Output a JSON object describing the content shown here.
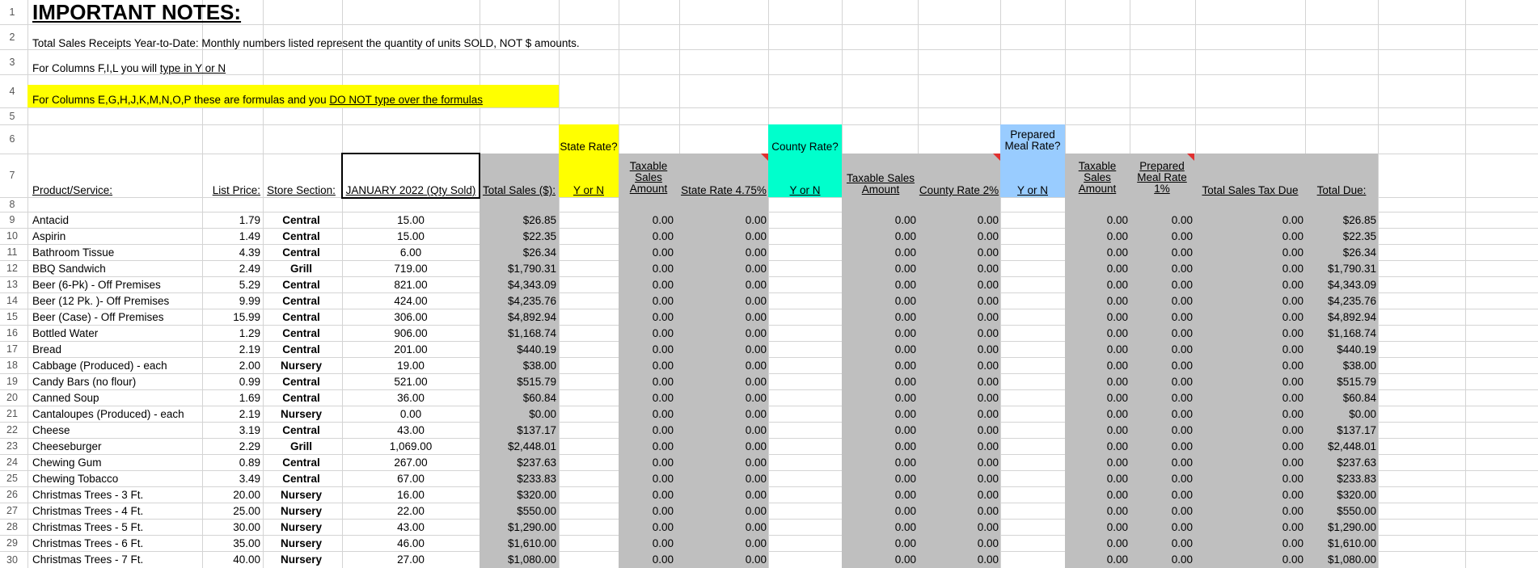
{
  "notes": {
    "title": "IMPORTANT NOTES:",
    "line2": "Total Sales Receipts Year-to-Date:  Monthly numbers listed represent the quantity of units SOLD, NOT $ amounts.",
    "line3_prefix": "For Columns F,I,L you will ",
    "line3_link": "type in Y or N",
    "line4_prefix": "For Columns E,G,H,J,K,M,N,O,P these are formulas and you ",
    "line4_link": "DO NOT type over the formulas"
  },
  "headers": {
    "product": "Product/Service:",
    "list_price": "List Price:",
    "store_section": "Store Section:",
    "qty": "JANUARY 2022  (Qty Sold)",
    "total_sales": "Total Sales ($):",
    "state_rate_q": "State Rate?",
    "state_yn": "Y or N",
    "taxable_state": "Taxable Sales Amount",
    "state_rate": "State Rate 4.75%",
    "county_rate_q": "County Rate?",
    "county_yn": "Y or N",
    "taxable_county": "Taxable Sales Amount",
    "county_rate": "County Rate 2%",
    "meal_rate_q": "Prepared Meal Rate?",
    "meal_yn": "Y or N",
    "taxable_meal": "Taxable Sales Amount",
    "meal_rate": "Prepared Meal Rate 1%",
    "tax_due": "Total Sales Tax Due",
    "total_due": "Total Due:"
  },
  "row_numbers": [
    "1",
    "2",
    "3",
    "4",
    "5",
    "6",
    "7",
    "8",
    "9",
    "10",
    "11",
    "12",
    "13",
    "14",
    "15",
    "16",
    "17",
    "18",
    "19",
    "20",
    "21",
    "22",
    "23",
    "24",
    "25",
    "26",
    "27",
    "28",
    "29",
    "30"
  ],
  "zero": "0.00",
  "colors": {
    "yellow": "#ffff00",
    "aqua": "#00ffcc",
    "light_blue": "#99ccff",
    "gray": "#bfbfbf",
    "grid": "#d4d4d4",
    "marker": "#e03030"
  },
  "rows": [
    {
      "product": "Antacid",
      "price": "1.79",
      "section": "Central",
      "qty": "15.00",
      "sales": "$26.85",
      "total": "$26.85"
    },
    {
      "product": "Aspirin",
      "price": "1.49",
      "section": "Central",
      "qty": "15.00",
      "sales": "$22.35",
      "total": "$22.35"
    },
    {
      "product": "Bathroom Tissue",
      "price": "4.39",
      "section": "Central",
      "qty": "6.00",
      "sales": "$26.34",
      "total": "$26.34"
    },
    {
      "product": "BBQ Sandwich",
      "price": "2.49",
      "section": "Grill",
      "qty": "719.00",
      "sales": "$1,790.31",
      "total": "$1,790.31"
    },
    {
      "product": "Beer (6-Pk) - Off Premises",
      "price": "5.29",
      "section": "Central",
      "qty": "821.00",
      "sales": "$4,343.09",
      "total": "$4,343.09"
    },
    {
      "product": "Beer (12 Pk. )- Off Premises",
      "price": "9.99",
      "section": "Central",
      "qty": "424.00",
      "sales": "$4,235.76",
      "total": "$4,235.76"
    },
    {
      "product": "Beer (Case) - Off Premises",
      "price": "15.99",
      "section": "Central",
      "qty": "306.00",
      "sales": "$4,892.94",
      "total": "$4,892.94"
    },
    {
      "product": "Bottled Water",
      "price": "1.29",
      "section": "Central",
      "qty": "906.00",
      "sales": "$1,168.74",
      "total": "$1,168.74"
    },
    {
      "product": "Bread",
      "price": "2.19",
      "section": "Central",
      "qty": "201.00",
      "sales": "$440.19",
      "total": "$440.19"
    },
    {
      "product": "Cabbage (Produced) - each",
      "price": "2.00",
      "section": "Nursery",
      "qty": "19.00",
      "sales": "$38.00",
      "total": "$38.00"
    },
    {
      "product": "Candy Bars (no flour)",
      "price": "0.99",
      "section": "Central",
      "qty": "521.00",
      "sales": "$515.79",
      "total": "$515.79"
    },
    {
      "product": "Canned Soup",
      "price": "1.69",
      "section": "Central",
      "qty": "36.00",
      "sales": "$60.84",
      "total": "$60.84"
    },
    {
      "product": "Cantaloupes (Produced) - each",
      "price": "2.19",
      "section": "Nursery",
      "qty": "0.00",
      "sales": "$0.00",
      "total": "$0.00"
    },
    {
      "product": "Cheese",
      "price": "3.19",
      "section": "Central",
      "qty": "43.00",
      "sales": "$137.17",
      "total": "$137.17"
    },
    {
      "product": "Cheeseburger",
      "price": "2.29",
      "section": "Grill",
      "qty": "1,069.00",
      "sales": "$2,448.01",
      "total": "$2,448.01"
    },
    {
      "product": "Chewing Gum",
      "price": "0.89",
      "section": "Central",
      "qty": "267.00",
      "sales": "$237.63",
      "total": "$237.63"
    },
    {
      "product": "Chewing Tobacco",
      "price": "3.49",
      "section": "Central",
      "qty": "67.00",
      "sales": "$233.83",
      "total": "$233.83"
    },
    {
      "product": "Christmas Trees - 3 Ft.",
      "price": "20.00",
      "section": "Nursery",
      "qty": "16.00",
      "sales": "$320.00",
      "total": "$320.00"
    },
    {
      "product": "Christmas Trees - 4 Ft.",
      "price": "25.00",
      "section": "Nursery",
      "qty": "22.00",
      "sales": "$550.00",
      "total": "$550.00"
    },
    {
      "product": "Christmas Trees - 5 Ft.",
      "price": "30.00",
      "section": "Nursery",
      "qty": "43.00",
      "sales": "$1,290.00",
      "total": "$1,290.00"
    },
    {
      "product": "Christmas Trees - 6 Ft.",
      "price": "35.00",
      "section": "Nursery",
      "qty": "46.00",
      "sales": "$1,610.00",
      "total": "$1,610.00"
    },
    {
      "product": "Christmas Trees - 7 Ft.",
      "price": "40.00",
      "section": "Nursery",
      "qty": "27.00",
      "sales": "$1,080.00",
      "total": "$1,080.00"
    }
  ]
}
